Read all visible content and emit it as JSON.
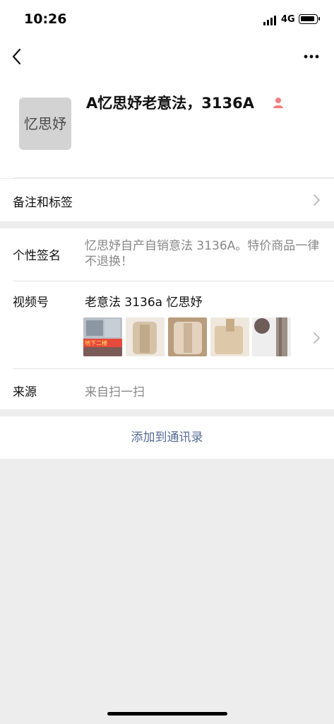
{
  "status_bar": {
    "time": "10:26",
    "network": "4G",
    "icons": [
      "signal-icon",
      "battery-icon"
    ]
  },
  "nav": {
    "back_icon": "chevron-left-icon",
    "more_icon": "more-dots-icon"
  },
  "profile": {
    "avatar_text": "忆思妤",
    "name": "A忆思妤老意法，3136A",
    "gender_icon": "person-icon",
    "gender_color": "#f37e7d"
  },
  "remarks": {
    "label": "备注和标签"
  },
  "signature": {
    "label": "个性签名",
    "value": "忆思妤自产自销意法 3136A。特价商品一律不退换！"
  },
  "channels": {
    "label": "视频号",
    "name": "老意法 3136a 忆思妤",
    "thumbnail_overlay": "地下二楼",
    "thumbnail_count": 5
  },
  "source": {
    "label": "来源",
    "value": "来自扫一扫"
  },
  "actions": {
    "add_contact": "添加到通讯录"
  },
  "colors": {
    "link": "#576b95",
    "secondary_text": "#888888",
    "background": "#ededed"
  }
}
